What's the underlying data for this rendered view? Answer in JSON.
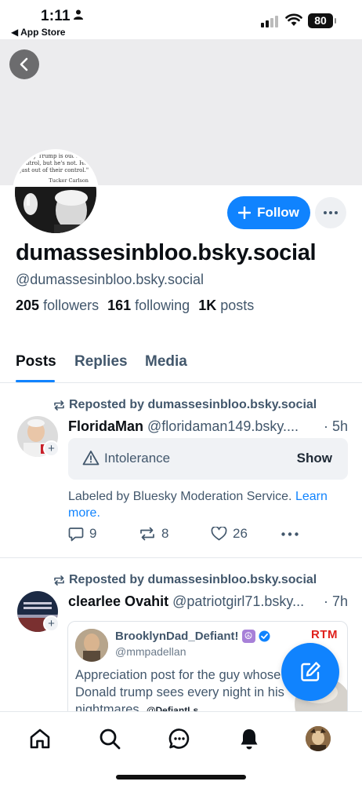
{
  "status_bar": {
    "time": "1:11",
    "back_app": "◀ App Store",
    "battery": "80"
  },
  "profile": {
    "avatar_quote": "\"...say Trump is out of control, but he's not. He's just out of their control.\"",
    "avatar_author": "Tucker Carlson",
    "follow_label": "Follow",
    "display_name": "dumassesinbloo.bsky.social",
    "handle": "@dumassesinbloo.bsky.social",
    "followers_count": "205",
    "followers_label": "followers",
    "following_count": "161",
    "following_label": "following",
    "posts_count": "1K",
    "posts_label": "posts"
  },
  "tabs": [
    {
      "label": "Posts",
      "active": true
    },
    {
      "label": "Replies",
      "active": false
    },
    {
      "label": "Media",
      "active": false
    }
  ],
  "posts": [
    {
      "repost_label": "Reposted by dumassesinbloo.bsky.social",
      "author": "FloridaMan",
      "handle": "@floridaman149.bsky....",
      "time": "· 5h",
      "warning_label": "Intolerance",
      "warning_action": "Show",
      "labeled_text": "Labeled by Bluesky Moderation Service.",
      "learn_more": "Learn more.",
      "replies": "9",
      "reposts": "8",
      "likes": "26"
    },
    {
      "repost_label": "Reposted by dumassesinbloo.bsky.social",
      "author": "clearlee Ovahit",
      "handle": "@patriotgirl71.bsky...",
      "time": "· 7h",
      "quote": {
        "name": "BrooklynDad_Defiant!",
        "handle": "@mmpadellan",
        "badge": "RTM",
        "text": "Appreciation post for the guy whose Donald trump sees every night in his nightmares.",
        "tag": "@DefiantLs"
      }
    }
  ],
  "icons": {
    "back": "chevron-left-icon",
    "more": "ellipsis-icon",
    "repost": "repost-icon",
    "warning": "warning-icon",
    "reply": "reply-icon",
    "like": "heart-icon",
    "compose": "compose-icon",
    "nav": [
      "home-icon",
      "search-icon",
      "chat-icon",
      "bell-icon",
      "profile-avatar"
    ]
  },
  "colors": {
    "accent": "#1083fe",
    "muted_text": "#42576c",
    "banner": "#ececee"
  }
}
